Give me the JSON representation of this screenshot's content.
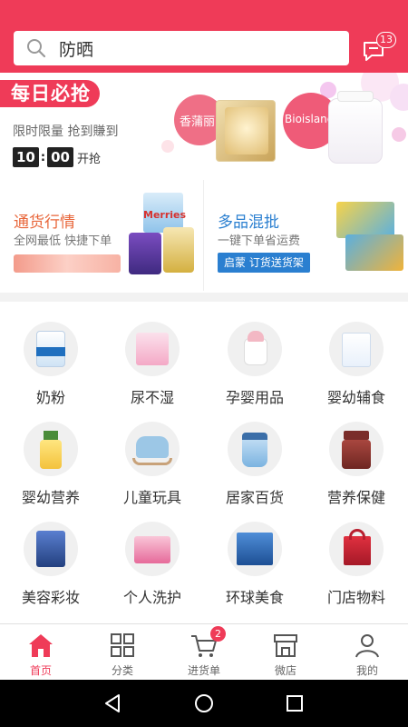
{
  "search": {
    "query": "防晒"
  },
  "messages": {
    "count": "13"
  },
  "daily": {
    "tag": "每日必抢",
    "desc": "限时限量  抢到賺到",
    "timer_h": "10",
    "timer_m": "00",
    "timer_suffix": "开抢",
    "brands": [
      "香蒲丽",
      "Bioisland"
    ]
  },
  "promos": [
    {
      "title": "通货行情",
      "subtitle": "全网最低  快捷下单",
      "color": "#e8663a",
      "product_label": "Merries"
    },
    {
      "title": "多品混批",
      "subtitle": "一键下单省运费",
      "color": "#2a7fd0",
      "button": "启蒙  订货送货架"
    }
  ],
  "categories": [
    {
      "label": "奶粉",
      "icon": "milk-powder-icon"
    },
    {
      "label": "尿不湿",
      "icon": "diaper-icon"
    },
    {
      "label": "孕婴用品",
      "icon": "baby-bottle-icon"
    },
    {
      "label": "婴幼辅食",
      "icon": "baby-food-icon"
    },
    {
      "label": "婴幼营养",
      "icon": "nutrition-icon"
    },
    {
      "label": "儿童玩具",
      "icon": "toy-horse-icon"
    },
    {
      "label": "居家百货",
      "icon": "water-jug-icon"
    },
    {
      "label": "营养保健",
      "icon": "supplement-icon"
    },
    {
      "label": "美容彩妆",
      "icon": "cosmetics-icon"
    },
    {
      "label": "个人洗护",
      "icon": "personal-care-icon"
    },
    {
      "label": "环球美食",
      "icon": "cereal-icon"
    },
    {
      "label": "门店物料",
      "icon": "store-bag-icon"
    }
  ],
  "tabs": [
    {
      "label": "首页",
      "icon": "home-icon",
      "active": true
    },
    {
      "label": "分类",
      "icon": "grid-icon"
    },
    {
      "label": "进货单",
      "icon": "cart-icon",
      "badge": "2"
    },
    {
      "label": "微店",
      "icon": "shop-icon"
    },
    {
      "label": "我的",
      "icon": "user-icon"
    }
  ],
  "colors": {
    "accent": "#ef3b58"
  }
}
